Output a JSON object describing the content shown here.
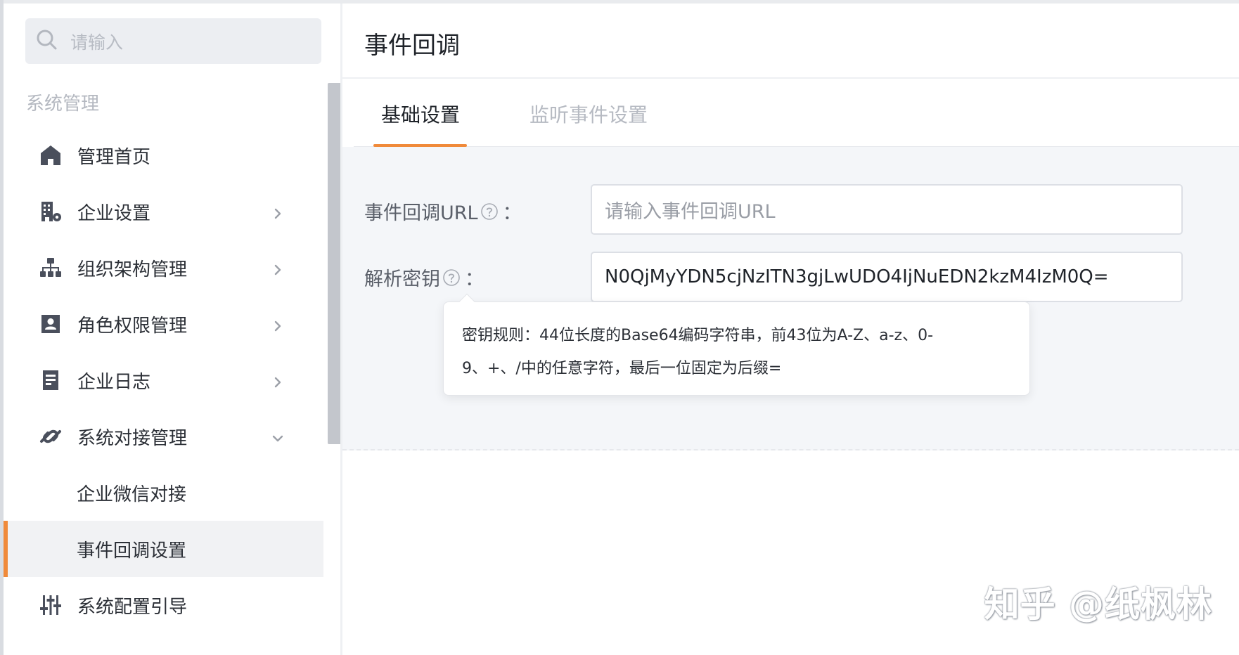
{
  "search": {
    "placeholder": "请输入"
  },
  "sidebar": {
    "section_title": "系统管理",
    "items": [
      {
        "label": "管理首页",
        "icon": "home-icon",
        "has_chevron": false
      },
      {
        "label": "企业设置",
        "icon": "building-settings-icon",
        "has_chevron": true
      },
      {
        "label": "组织架构管理",
        "icon": "org-chart-icon",
        "has_chevron": true
      },
      {
        "label": "角色权限管理",
        "icon": "user-badge-icon",
        "has_chevron": true
      },
      {
        "label": "企业日志",
        "icon": "document-icon",
        "has_chevron": true
      },
      {
        "label": "系统对接管理",
        "icon": "link-icon",
        "has_chevron": true,
        "expanded": true
      }
    ],
    "sub_items": [
      {
        "label": "企业微信对接",
        "active": false
      },
      {
        "label": "事件回调设置",
        "active": true
      }
    ],
    "last_item": {
      "label": "系统配置引导",
      "icon": "sliders-icon"
    }
  },
  "page": {
    "title": "事件回调"
  },
  "tabs": [
    {
      "label": "基础设置",
      "active": true
    },
    {
      "label": "监听事件设置",
      "active": false
    }
  ],
  "form": {
    "callback_url": {
      "label": "事件回调URL",
      "colon": "：",
      "placeholder": "请输入事件回调URL",
      "value": ""
    },
    "secret_key": {
      "label": "解析密钥",
      "colon": "：",
      "value": "N0QjMyYDN5cjNzITN3gjLwUDO4IjNuEDN2kzM4IzM0Q="
    }
  },
  "tooltip": {
    "line1": "密钥规则：44位长度的Base64编码字符串，前43位为A-Z、a-z、0-",
    "line2": "9、+、/中的任意字符，最后一位固定为后缀="
  },
  "watermark": "知乎 @纸枫林",
  "colors": {
    "accent": "#f08a3a",
    "panel_bg": "#f4f6f9",
    "icon": "#4a4f5c"
  }
}
